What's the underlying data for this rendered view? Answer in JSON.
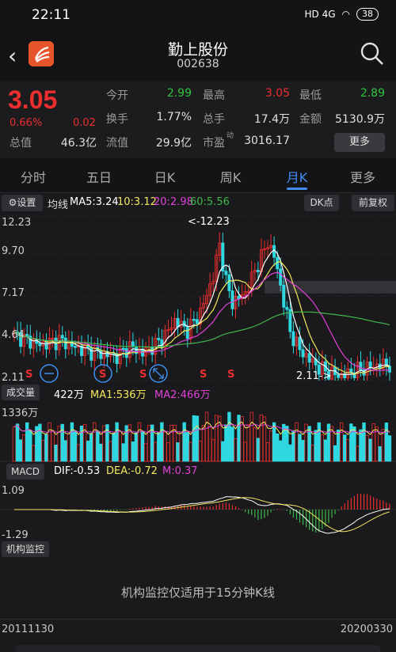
{
  "status": {
    "time": "22:11",
    "network": "HD 4G",
    "battery": "38"
  },
  "header": {
    "title": "勤上股份",
    "code": "002638"
  },
  "quote": {
    "price": "3.05",
    "change_pct": "0.66%",
    "change": "0.02",
    "rows": [
      [
        {
          "label": "今开",
          "value": "2.99",
          "color": "green"
        },
        {
          "label": "最高",
          "value": "3.05",
          "color": "red"
        },
        {
          "label": "最低",
          "value": "2.89",
          "color": "green"
        }
      ],
      [
        {
          "label": "换手",
          "value": "1.77%",
          "color": "white"
        },
        {
          "label": "总手",
          "value": "17.4万",
          "color": "white"
        },
        {
          "label": "金额",
          "value": "5130.9万",
          "color": "white"
        }
      ],
      [
        {
          "label": "流值",
          "value": "29.9亿",
          "color": "white"
        },
        {
          "label": "市盈",
          "value": "3016.17",
          "color": "white",
          "sup": "动"
        }
      ]
    ],
    "total_label": "总值",
    "total_value": "46.3亿",
    "more_label": "更多"
  },
  "tabs": [
    "分时",
    "五日",
    "日K",
    "周K",
    "月K",
    "更多"
  ],
  "active_tab": "月K",
  "kline": {
    "settings_label": "设置",
    "ma_label": "均线",
    "ma5": "MA5:3.24",
    "ma10": "10:3.12",
    "ma20": "20:2.98",
    "ma60": "60:5.56",
    "dk_label": "DK点",
    "fq_label": "前复权",
    "y_labels": [
      "12.23",
      "9.70",
      "7.17",
      "4.64",
      "2.11"
    ],
    "high_mark": "12.23",
    "low_mark": "2.11",
    "signals": [
      "S",
      "S",
      "S",
      "S",
      "S"
    ]
  },
  "volume": {
    "label": "成交量",
    "value": "422万",
    "ma1": "MA1:536万",
    "ma2": "MA2:466万",
    "max_label": "1336万"
  },
  "macd": {
    "label": "MACD",
    "dif": "DIF:-0.53",
    "dea": "DEA:-0.72",
    "m": "M:0.37",
    "top_label": "1.09",
    "bottom_label": "-1.29"
  },
  "inst": {
    "label": "机构监控",
    "notice": "机构监控仅适用于15分钟K线"
  },
  "dates": {
    "start": "20111130",
    "end": "20200330"
  },
  "colors": {
    "up": "#ec2e2e",
    "down": "#2fd8e0",
    "ma5": "#ffffff",
    "ma10": "#f2e85a",
    "ma20": "#e041d6",
    "ma60": "#3fb84a",
    "accent": "#3f8df2"
  },
  "chart_data": {
    "type": "candlestick",
    "x_range": [
      "20111130",
      "20200330"
    ],
    "ylim": [
      2.11,
      12.23
    ],
    "y_ticks": [
      12.23,
      9.7,
      7.17,
      4.64,
      2.11
    ],
    "annotations": [
      {
        "text": "12.23",
        "kind": "max"
      },
      {
        "text": "2.11",
        "kind": "min"
      }
    ],
    "current": {
      "ma5": 3.24,
      "ma10": 3.12,
      "ma20": 2.98,
      "ma60": 5.56
    },
    "volume": {
      "last": "422万",
      "ma1": "536万",
      "ma2": "466万",
      "max": "1336万"
    },
    "macd": {
      "dif": -0.53,
      "dea": -0.72,
      "m": 0.37,
      "ylim": [
        -1.29,
        1.09
      ]
    }
  }
}
